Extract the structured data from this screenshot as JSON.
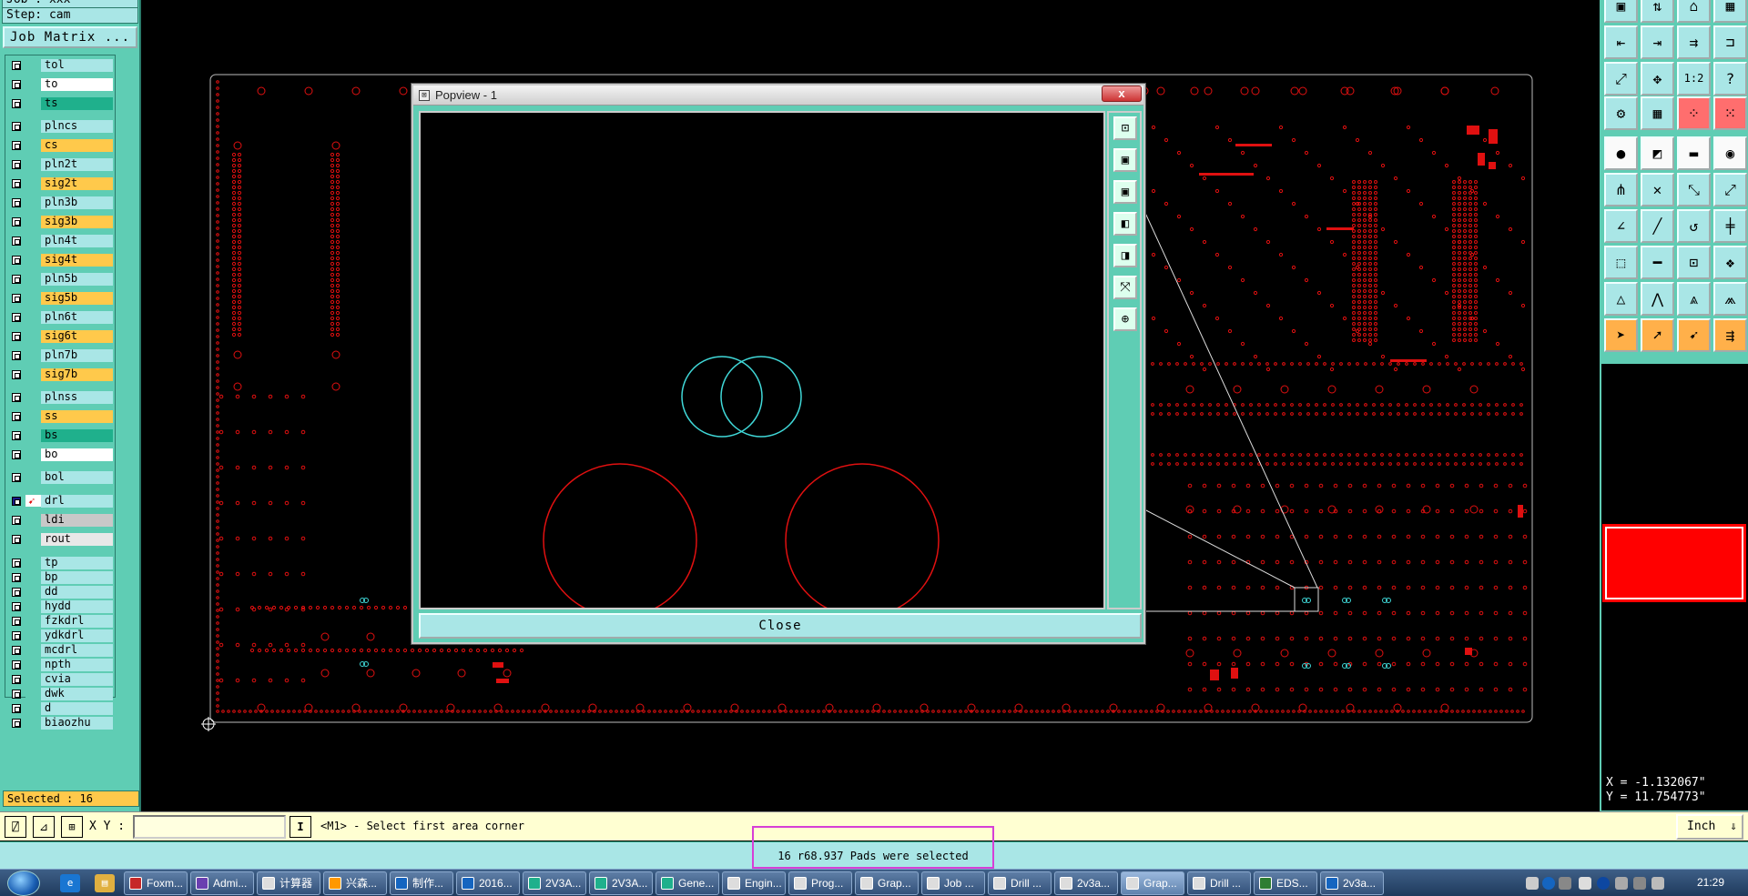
{
  "left_panel": {
    "job_line": "Job : xxx",
    "step_line": "Step: cam",
    "job_matrix_label": "Job Matrix ...",
    "selected_label": "Selected : 16",
    "layers": [
      {
        "name": "tol",
        "color": "#a9e6e6"
      },
      {
        "name": "to",
        "color": "#ffffff"
      },
      {
        "name": "ts",
        "color": "#1fb08c"
      },
      {
        "name": "plncs",
        "color": "#a9e6e6"
      },
      {
        "name": "cs",
        "color": "#ffc94b"
      },
      {
        "name": "pln2t",
        "color": "#a9e6e6"
      },
      {
        "name": "sig2t",
        "color": "#ffc94b"
      },
      {
        "name": "pln3b",
        "color": "#a9e6e6"
      },
      {
        "name": "sig3b",
        "color": "#ffc94b"
      },
      {
        "name": "pln4t",
        "color": "#a9e6e6"
      },
      {
        "name": "sig4t",
        "color": "#ffc94b"
      },
      {
        "name": "pln5b",
        "color": "#a9e6e6"
      },
      {
        "name": "sig5b",
        "color": "#ffc94b"
      },
      {
        "name": "pln6t",
        "color": "#a9e6e6"
      },
      {
        "name": "sig6t",
        "color": "#ffc94b"
      },
      {
        "name": "pln7b",
        "color": "#a9e6e6"
      },
      {
        "name": "sig7b",
        "color": "#ffc94b"
      },
      {
        "name": "plnss",
        "color": "#a9e6e6"
      },
      {
        "name": "ss",
        "color": "#ffc94b"
      },
      {
        "name": "bs",
        "color": "#1fb08c"
      },
      {
        "name": "bo",
        "color": "#ffffff"
      },
      {
        "name": "bol",
        "color": "#a9e6e6"
      },
      {
        "name": "drl",
        "color": "#a9e6e6",
        "active": true
      },
      {
        "name": "ldi",
        "color": "#c8c8c8"
      },
      {
        "name": "rout",
        "color": "#e8e8e8"
      },
      {
        "name": "tp",
        "color": "#a9e6e6"
      },
      {
        "name": "bp",
        "color": "#a9e6e6"
      },
      {
        "name": "dd",
        "color": "#a9e6e6"
      },
      {
        "name": "hydd",
        "color": "#a9e6e6"
      },
      {
        "name": "fzkdrl",
        "color": "#a9e6e6"
      },
      {
        "name": "ydkdrl",
        "color": "#a9e6e6"
      },
      {
        "name": "mcdrl",
        "color": "#a9e6e6"
      },
      {
        "name": "npth",
        "color": "#a9e6e6"
      },
      {
        "name": "cvia",
        "color": "#a9e6e6"
      },
      {
        "name": "dwk",
        "color": "#a9e6e6"
      },
      {
        "name": "d",
        "color": "#a9e6e6"
      },
      {
        "name": "biaozhu",
        "color": "#a9e6e6"
      }
    ]
  },
  "popview": {
    "title": "Popview - 1",
    "close_x": "x",
    "close_button": "Close",
    "tools": [
      "pan-left-icon",
      "zoom-in-icon",
      "zoom-out-icon",
      "fit-left-icon",
      "fit-right-icon",
      "zoom-fit-icon",
      "zoom-home-icon"
    ]
  },
  "right_toolbar": {
    "buttons": [
      {
        "icon": "select-icon",
        "glyph": "▣",
        "style": ""
      },
      {
        "icon": "move-icon",
        "glyph": "⇅",
        "style": ""
      },
      {
        "icon": "home-icon",
        "glyph": "⌂",
        "style": ""
      },
      {
        "icon": "grid-icon",
        "glyph": "▦",
        "style": ""
      },
      {
        "icon": "undo-icon",
        "glyph": "⇤",
        "style": ""
      },
      {
        "icon": "redo-icon",
        "glyph": "⇥",
        "style": ""
      },
      {
        "icon": "step-icon",
        "glyph": "⇉",
        "style": ""
      },
      {
        "icon": "snap-icon",
        "glyph": "⊐",
        "style": ""
      },
      {
        "icon": "zoom-fit-icon",
        "glyph": "⤢",
        "style": ""
      },
      {
        "icon": "zoom-center-icon",
        "glyph": "✥",
        "style": ""
      },
      {
        "icon": "scale-icon",
        "glyph": "1:2",
        "style": ""
      },
      {
        "icon": "help-icon",
        "glyph": "?",
        "style": ""
      },
      {
        "icon": "measure-icon",
        "glyph": "⚙",
        "style": ""
      },
      {
        "icon": "grid-toggle-icon",
        "glyph": "▦",
        "style": ""
      },
      {
        "icon": "snap-on-icon",
        "glyph": "⁘",
        "style": "red"
      },
      {
        "icon": "snap-off-icon",
        "glyph": "⁙",
        "style": "red"
      },
      {
        "icon": "pad-icon",
        "glyph": "●",
        "style": "white"
      },
      {
        "icon": "line-icon",
        "glyph": "◩",
        "style": "white"
      },
      {
        "icon": "ruler-icon",
        "glyph": "▬",
        "style": "white"
      },
      {
        "icon": "circle-icon",
        "glyph": "◉",
        "style": "white"
      },
      {
        "icon": "node-icon",
        "glyph": "⋔",
        "style": ""
      },
      {
        "icon": "cross-icon",
        "glyph": "✕",
        "style": ""
      },
      {
        "icon": "connect-icon",
        "glyph": "⤡",
        "style": ""
      },
      {
        "icon": "link-icon",
        "glyph": "⤢",
        "style": ""
      },
      {
        "icon": "angle-icon",
        "glyph": "∠",
        "style": ""
      },
      {
        "icon": "slash-icon",
        "glyph": "╱",
        "style": ""
      },
      {
        "icon": "arc-icon",
        "glyph": "↺",
        "style": ""
      },
      {
        "icon": "split-icon",
        "glyph": "╪",
        "style": ""
      },
      {
        "icon": "pad-add-icon",
        "glyph": "⬚",
        "style": ""
      },
      {
        "icon": "minus-icon",
        "glyph": "━",
        "style": ""
      },
      {
        "icon": "bracket-icon",
        "glyph": "⊡",
        "style": ""
      },
      {
        "icon": "group-icon",
        "glyph": "❖",
        "style": ""
      },
      {
        "icon": "triangle-icon",
        "glyph": "△",
        "style": ""
      },
      {
        "icon": "peak-icon",
        "glyph": "⋀",
        "style": ""
      },
      {
        "icon": "arch-icon",
        "glyph": "⩓",
        "style": ""
      },
      {
        "icon": "wide-arch-icon",
        "glyph": "⩕",
        "style": ""
      },
      {
        "icon": "pointer-icon",
        "glyph": "➤",
        "style": "orange"
      },
      {
        "icon": "pointer-select-icon",
        "glyph": "➚",
        "style": "orange"
      },
      {
        "icon": "pointer-move-icon",
        "glyph": "➹",
        "style": "orange"
      },
      {
        "icon": "pointer-multi-icon",
        "glyph": "⇶",
        "style": "orange"
      }
    ]
  },
  "coords": {
    "x": "X = -1.132067\"",
    "y": "Y = 11.754773\""
  },
  "command_bar": {
    "xy_label": "X Y :",
    "xy_value": "",
    "prompt": "<M1> - Select first area corner",
    "unit": "Inch",
    "unit_arrow": "⇓"
  },
  "status_message": "16 r68.937 Pads were selected",
  "taskbar": {
    "items": [
      {
        "label": "Foxm...",
        "color": "#c62828"
      },
      {
        "label": "Admi...",
        "color": "#6a3fb0"
      },
      {
        "label": "计算器",
        "color": "#dddddd"
      },
      {
        "label": "兴森...",
        "color": "#ff9800"
      },
      {
        "label": "制作...",
        "color": "#1565c0"
      },
      {
        "label": "2016...",
        "color": "#1565c0"
      },
      {
        "label": "2V3A...",
        "color": "#1fb08c"
      },
      {
        "label": "2V3A...",
        "color": "#1fb08c"
      },
      {
        "label": "Gene...",
        "color": "#1fb08c"
      },
      {
        "label": "Engin...",
        "color": "#dddddd"
      },
      {
        "label": "Prog...",
        "color": "#dddddd"
      },
      {
        "label": "Grap...",
        "color": "#dddddd"
      },
      {
        "label": "Job ...",
        "color": "#dddddd"
      },
      {
        "label": "Drill ...",
        "color": "#dddddd"
      },
      {
        "label": "2v3a...",
        "color": "#dddddd"
      },
      {
        "label": "Grap...",
        "color": "#dddddd",
        "active": true
      },
      {
        "label": "Drill ...",
        "color": "#dddddd"
      },
      {
        "label": "EDS...",
        "color": "#2e7d32"
      },
      {
        "label": "2v3a...",
        "color": "#1565c0"
      }
    ],
    "clock": "21:29"
  },
  "colors": {
    "accent": "#5fcdb4",
    "pad_red": "#e01010",
    "selection_cyan": "#40d8d8",
    "prompt_bg": "#ffffd2"
  }
}
